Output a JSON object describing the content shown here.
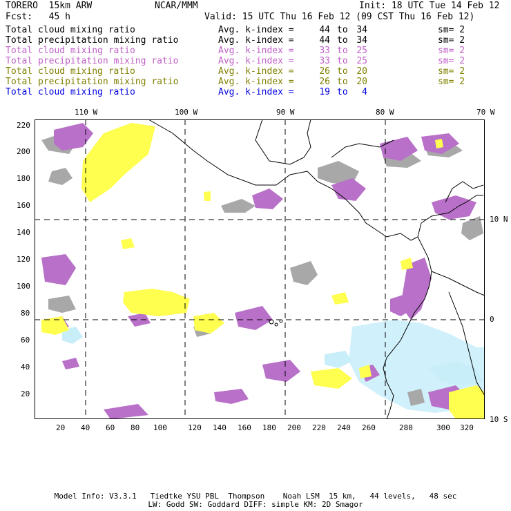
{
  "header": {
    "model": "TORERO  15km ARW",
    "org": "NCAR/MMM",
    "init": "Init: 18 UTC Tue 14 Feb 12",
    "fcst": "Fcst:   45 h",
    "valid": "Valid: 15 UTC Thu 16 Feb 12 (09 CST Thu 16 Feb 12)"
  },
  "legend": [
    {
      "field": "Total cloud mixing ratio",
      "avg": "Avg. k-index =",
      "lo": "44",
      "to": "to",
      "hi": "34",
      "sm": "sm= 2",
      "color": "#000000"
    },
    {
      "field": "Total precipitation mixing ratio",
      "avg": "Avg. k-index =",
      "lo": "44",
      "to": "to",
      "hi": "34",
      "sm": "sm= 2",
      "color": "#000000"
    },
    {
      "field": "Total cloud mixing ratio",
      "avg": "Avg. k-index =",
      "lo": "33",
      "to": "to",
      "hi": "25",
      "sm": "sm= 2",
      "color": "#c060c8"
    },
    {
      "field": "Total precipitation mixing ratio",
      "avg": "Avg. k-index =",
      "lo": "33",
      "to": "to",
      "hi": "25",
      "sm": "sm= 2",
      "color": "#c060c8"
    },
    {
      "field": "Total cloud mixing ratio",
      "avg": "Avg. k-index =",
      "lo": "26",
      "to": "to",
      "hi": "20",
      "sm": "sm= 2",
      "color": "#808000"
    },
    {
      "field": "Total precipitation mixing ratio",
      "avg": "Avg. k-index =",
      "lo": "26",
      "to": "to",
      "hi": "20",
      "sm": "sm= 2",
      "color": "#808000"
    },
    {
      "field": "Total cloud mixing ratio",
      "avg": "Avg. k-index =",
      "lo": "19",
      "to": "to",
      "hi": "4",
      "sm": "",
      "color": "#0000e0"
    }
  ],
  "map": {
    "top_lon_labels": [
      "110 W",
      "100 W",
      "90 W",
      "80 W",
      "70 W"
    ],
    "right_lat_labels": [
      "10 N",
      "0",
      "10 S"
    ],
    "y_ticks": [
      "220",
      "200",
      "180",
      "160",
      "140",
      "120",
      "100",
      "80",
      "60",
      "40",
      "20"
    ],
    "x_ticks": [
      "20",
      "40",
      "60",
      "80",
      "100",
      "120",
      "140",
      "160",
      "180",
      "200",
      "220",
      "240",
      "260",
      "280",
      "300",
      "320"
    ],
    "fill_colors": {
      "gray": "#a8a8a8",
      "purple": "#b870c8",
      "yellow": "#ffff50",
      "cyan": "#c8eefa"
    }
  },
  "footer": {
    "line1": "Model Info: V3.3.1   Tiedtke YSU PBL  Thompson    Noah LSM  15 km,   44 levels,   48 sec",
    "line2": "LW: Godd SW: Goddard DIFF: simple KM: 2D Smagor"
  }
}
